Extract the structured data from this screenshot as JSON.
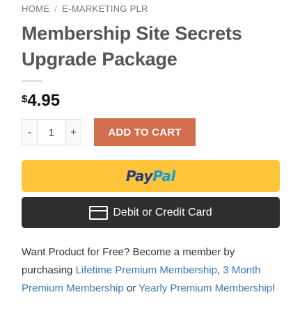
{
  "breadcrumb": {
    "home": "HOME",
    "separator": "/",
    "category": "E-MARKETING PLR"
  },
  "product": {
    "title": "Membership Site Secrets Upgrade Package",
    "currency_symbol": "$",
    "price": "4.95"
  },
  "quantity": {
    "minus": "-",
    "value": "1",
    "plus": "+"
  },
  "cart": {
    "add_label": "ADD TO CART"
  },
  "payment": {
    "paypal_pay": "Pay",
    "paypal_pal": "Pal",
    "card_label": "Debit or Credit Card"
  },
  "promo": {
    "intro": "Want Product for Free? Become a member by purchasing ",
    "link_lifetime": "Lifetime Premium Membership",
    "comma": ", ",
    "link_3month": "3 Month Premium Membership",
    "or": " or ",
    "link_yearly": "Yearly Premium Membership",
    "end": "!"
  },
  "colors": {
    "accent": "#d26e4b",
    "paypal_yellow": "#ffc439",
    "paypal_dark_blue": "#253b80",
    "paypal_light_blue": "#179bd7",
    "card_button": "#2c2e2f",
    "link": "#3a77b8",
    "title": "#555555"
  },
  "icons": {
    "card": "credit-card-icon"
  }
}
